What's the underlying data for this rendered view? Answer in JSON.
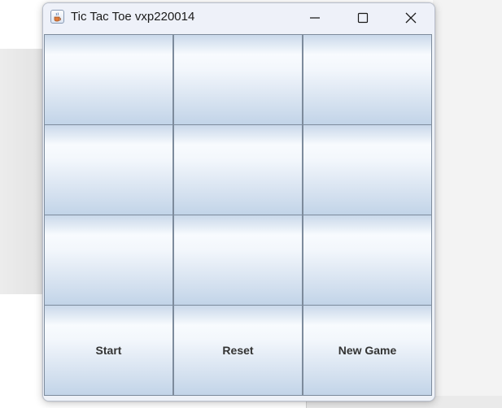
{
  "window": {
    "title": "Tic Tac Toe vxp220014",
    "app_icon": "java-cup-icon",
    "controls": {
      "minimize_icon": "minimize-icon",
      "maximize_icon": "maximize-icon",
      "close_icon": "close-icon"
    }
  },
  "board": {
    "cells": [
      "",
      "",
      "",
      "",
      "",
      "",
      "",
      "",
      ""
    ]
  },
  "controls": {
    "start_label": "Start",
    "reset_label": "Reset",
    "new_game_label": "New Game"
  },
  "colors": {
    "button_gradient_top": "#f8fbfe",
    "button_gradient_bottom": "#c2d4e8",
    "button_border": "#7d8b9c",
    "titlebar": "#eef1f9"
  }
}
